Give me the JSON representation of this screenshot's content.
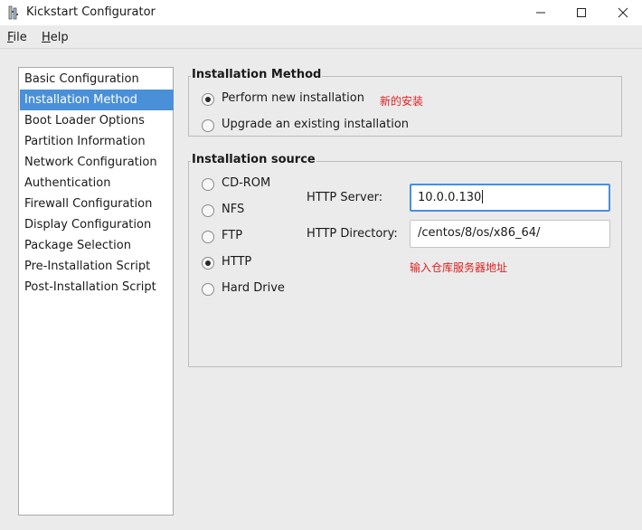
{
  "window": {
    "title": "Kickstart Configurator"
  },
  "menubar": {
    "file_accel": "F",
    "file_rest": "ile",
    "help_accel": "H",
    "help_rest": "elp"
  },
  "sidebar": {
    "items": [
      {
        "label": "Basic Configuration"
      },
      {
        "label": "Installation Method",
        "selected": true
      },
      {
        "label": "Boot Loader Options"
      },
      {
        "label": "Partition Information"
      },
      {
        "label": "Network Configuration"
      },
      {
        "label": "Authentication"
      },
      {
        "label": "Firewall Configuration"
      },
      {
        "label": "Display Configuration"
      },
      {
        "label": "Package Selection"
      },
      {
        "label": "Pre-Installation Script"
      },
      {
        "label": "Post-Installation Script"
      }
    ]
  },
  "installation_method": {
    "title": "Installation Method",
    "options": [
      {
        "label": "Perform new installation",
        "checked": true
      },
      {
        "label": "Upgrade an existing installation",
        "checked": false
      }
    ],
    "note": "新的安装"
  },
  "installation_source": {
    "title": "Installation source",
    "options": [
      {
        "label": "CD-ROM",
        "checked": false
      },
      {
        "label": "NFS",
        "checked": false
      },
      {
        "label": "FTP",
        "checked": false
      },
      {
        "label": "HTTP",
        "checked": true
      },
      {
        "label": "Hard Drive",
        "checked": false
      }
    ],
    "server_label": "HTTP Server:",
    "server_value": "10.0.0.130",
    "directory_label": "HTTP Directory:",
    "directory_value": "/centos/8/os/x86_64/",
    "note": "输入仓库服务器地址"
  },
  "colors": {
    "selection": "#4a90d9",
    "note": "#e02020",
    "background": "#ebebeb"
  }
}
